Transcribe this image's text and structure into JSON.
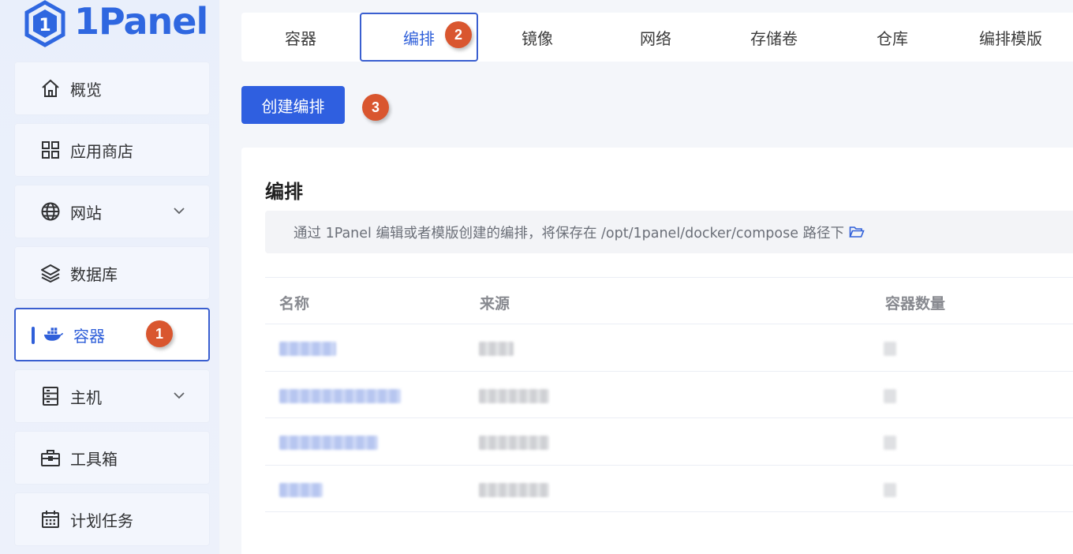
{
  "brand": {
    "name": "1Panel",
    "accent": "#2f5fd9",
    "badge_color": "#d9562f"
  },
  "sidebar": {
    "items": [
      {
        "label": "概览",
        "icon": "home-icon",
        "has_arrow": false,
        "active": false
      },
      {
        "label": "应用商店",
        "icon": "apps-grid-icon",
        "has_arrow": false,
        "active": false
      },
      {
        "label": "网站",
        "icon": "globe-icon",
        "has_arrow": true,
        "active": false
      },
      {
        "label": "数据库",
        "icon": "layers-icon",
        "has_arrow": false,
        "active": false
      },
      {
        "label": "容器",
        "icon": "docker-icon",
        "has_arrow": false,
        "active": true,
        "step": "1"
      },
      {
        "label": "主机",
        "icon": "server-icon",
        "has_arrow": true,
        "active": false
      },
      {
        "label": "工具箱",
        "icon": "toolbox-icon",
        "has_arrow": false,
        "active": false
      },
      {
        "label": "计划任务",
        "icon": "calendar-icon",
        "has_arrow": false,
        "active": false
      }
    ]
  },
  "tabs": [
    {
      "label": "容器",
      "active": false
    },
    {
      "label": "编排",
      "active": true,
      "step": "2"
    },
    {
      "label": "镜像",
      "active": false
    },
    {
      "label": "网络",
      "active": false
    },
    {
      "label": "存储卷",
      "active": false
    },
    {
      "label": "仓库",
      "active": false
    },
    {
      "label": "编排模版",
      "active": false
    }
  ],
  "toolbar": {
    "create_label": "创建编排",
    "step": "3"
  },
  "card": {
    "title": "编排",
    "notice": "通过 1Panel 编辑或者模版创建的编排，将保存在 /opt/1panel/docker/compose 路径下"
  },
  "table": {
    "columns": [
      "名称",
      "来源",
      "容器数量"
    ],
    "rows": 4
  }
}
